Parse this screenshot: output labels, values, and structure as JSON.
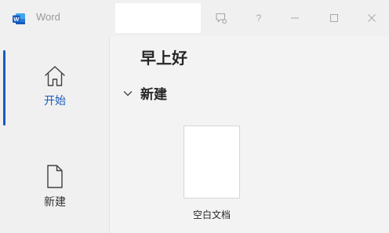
{
  "titlebar": {
    "app_name": "Word",
    "help_label": "?",
    "logo_icon": "word-logo-icon",
    "logo_letter": "W",
    "accent": "#185abd"
  },
  "nav": {
    "items": [
      {
        "label": "开始",
        "icon": "home-icon",
        "active": true
      },
      {
        "label": "新建",
        "icon": "new-document-icon",
        "active": false
      }
    ]
  },
  "main": {
    "greeting": "早上好",
    "new_section": {
      "title": "新建",
      "templates": [
        {
          "label": "空白文档"
        }
      ]
    }
  }
}
